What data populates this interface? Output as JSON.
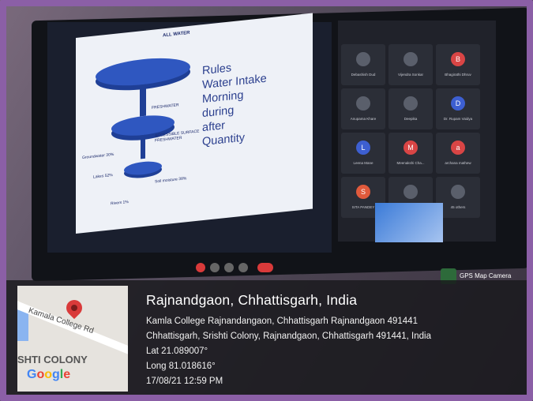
{
  "slide": {
    "title": "ALL WATER",
    "rules_text": "Rules\n Water Intake\nMorning\nduring\nafter\nQuantity",
    "diagram_labels": [
      "FRESHWATER",
      "ACCESSIBLE SURFACE FRESHWATER",
      "Lakes 52%",
      "Soil moisture 38%",
      "Rivers 1%",
      "Groundwater 30%"
    ]
  },
  "participants": [
    {
      "initial": "",
      "name": "Debashish Dud",
      "color": "#5a5f6b"
    },
    {
      "initial": "",
      "name": "Vijendra Sonkar",
      "color": "#5a5f6b"
    },
    {
      "initial": "B",
      "name": "Bhagirathi Dhruv",
      "color": "#d94545"
    },
    {
      "initial": "",
      "name": "Anupama Khare",
      "color": "#5a5f6b"
    },
    {
      "initial": "",
      "name": "Deepika",
      "color": "#5a5f6b"
    },
    {
      "initial": "D",
      "name": "Dr. Rupam Vaidya",
      "color": "#3d5fd1"
    },
    {
      "initial": "L",
      "name": "Leena Mane",
      "color": "#3d5fd1"
    },
    {
      "initial": "M",
      "name": "Meenakshi Cha...",
      "color": "#d94545"
    },
    {
      "initial": "a",
      "name": "archana mathew",
      "color": "#d94545"
    },
    {
      "initial": "S",
      "name": "SITA PANDEY",
      "color": "#e05a3c"
    },
    {
      "initial": "",
      "name": "ankita dhurve",
      "color": "#5a5f6b"
    },
    {
      "initial": "",
      "name": "45 others",
      "color": "#5a5f6b"
    }
  ],
  "gps_camera_label": "GPS Map Camera",
  "map": {
    "road_label": "Kamala College Rd",
    "area_label": "SHTI COLONY",
    "google": [
      "G",
      "o",
      "o",
      "g",
      "l",
      "e"
    ]
  },
  "location": {
    "place": "Rajnandgaon, Chhattisgarh, India",
    "address1": "Kamla College Rajnandangaon, Chhattisgarh Rajnandgaon 491441",
    "address2": "Chhattisgarh, Srishti Colony, Rajnandgaon, Chhattisgarh 491441, India",
    "lat": "Lat 21.089007°",
    "long": "Long 81.018616°",
    "datetime": "17/08/21 12:59 PM"
  }
}
